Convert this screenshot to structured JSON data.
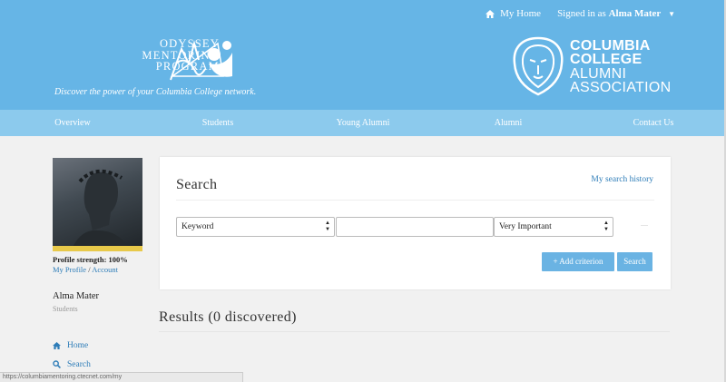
{
  "topbar": {
    "home_label": "My Home",
    "signed_prefix": "Signed in as",
    "user_name": "Alma Mater",
    "home_icon": "home-icon",
    "caret_icon": "caret-down-icon"
  },
  "brand_left": {
    "line1": "ODYSSEY",
    "line2": "MENTORING",
    "line3": "PROGRAM",
    "tagline": "Discover the power of your Columbia College network."
  },
  "brand_right": {
    "line1": "COLUMBIA",
    "line2": "COLLEGE",
    "line3": "ALUMNI",
    "line4": "ASSOCIATION"
  },
  "nav": {
    "items": [
      "Overview",
      "Students",
      "Young Alumni",
      "Alumni",
      "Contact Us"
    ]
  },
  "sidebar": {
    "strength_label": "Profile strength: 100%",
    "my_profile": "My Profile",
    "separator": "/",
    "account": "Account",
    "user_name": "Alma Mater",
    "user_role": "Students",
    "menu": [
      {
        "label": "Home",
        "icon": "home-icon"
      },
      {
        "label": "Search",
        "icon": "search-icon"
      }
    ]
  },
  "search": {
    "title": "Search",
    "history_link": "My search history",
    "field_select": "Keyword",
    "keyword_value": "",
    "importance_select": "Very Important",
    "add_button": "Add criterion",
    "search_button": "Search"
  },
  "results": {
    "heading": "Results (0 discovered)"
  },
  "statusbar": {
    "url": "https://columbiamentoring.ctecnet.com/my"
  },
  "colors": {
    "header": "#66b5e6",
    "nav": "#8ccaed",
    "button": "#6ab3e3",
    "link": "#2e7db8"
  }
}
